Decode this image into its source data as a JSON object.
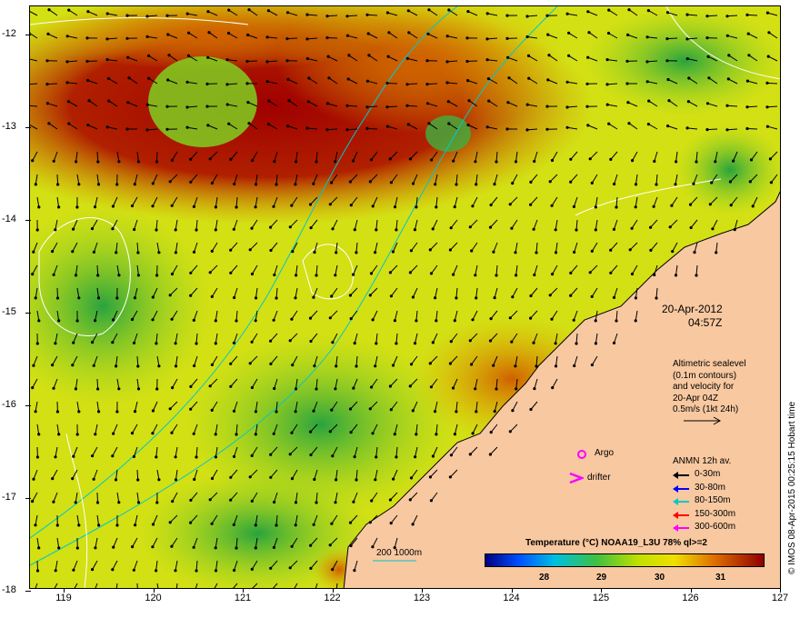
{
  "map": {
    "date": "20-Apr-2012",
    "time": "04:57Z",
    "info_lines": [
      "Altimetric sealevel",
      "(0.1m contours)",
      "and velocity for",
      "20-Apr 04Z",
      "0.5m/s (1kt 24h)"
    ],
    "y_ticks": [
      "-12",
      "-13",
      "-14",
      "-15",
      "-16",
      "-17",
      "-18"
    ],
    "x_ticks": [
      "119",
      "120",
      "121",
      "122",
      "123",
      "124",
      "125",
      "126",
      "127"
    ],
    "markers": {
      "argo_label": "Argo",
      "drifter_label": "drifter"
    },
    "anmn": {
      "title": "ANMN 12h av.",
      "items": [
        {
          "label": "0-30m",
          "color": "#000000"
        },
        {
          "label": "30-80m",
          "color": "#0000ff"
        },
        {
          "label": "80-150m",
          "color": "#00c8c8"
        },
        {
          "label": "150-300m",
          "color": "#ff0000"
        },
        {
          "label": "300-600m",
          "color": "#ff00ff"
        }
      ]
    },
    "isobath_label": "200  1000m",
    "colorbar": {
      "title": "Temperature (°C) NOAA19_L3U 78% ql>=2",
      "ticks": [
        "28",
        "29",
        "30",
        "31"
      ]
    },
    "credit": "© IMOS 08-Apr-2015 00:25:15 Hobart time",
    "colors": {
      "land": "#f8c8a0",
      "warm": "#a00000",
      "mid": "#e8e000",
      "cool": "#30b040",
      "contour": "#ffffff",
      "isobath": "#00c8c8"
    }
  }
}
